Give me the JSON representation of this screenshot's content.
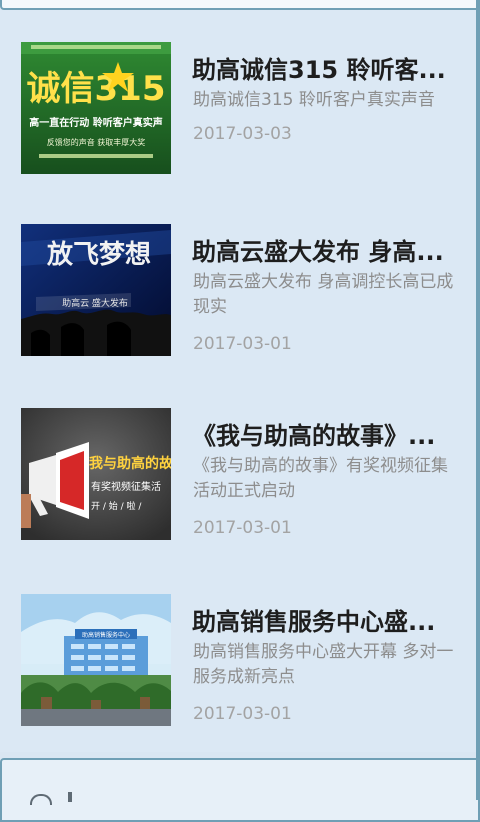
{
  "news": [
    {
      "title": "助高诚信315 聆听客...",
      "summary": "助高诚信315 聆听客户真实声音",
      "date": "2017-03-03",
      "thumb_text": "诚信315",
      "thumb_line1": "高一直在行动 聆听客户真实声",
      "thumb_line2": "反馈您的声音 获取丰厚大奖"
    },
    {
      "title": "助高云盛大发布 身高...",
      "summary": "助高云盛大发布 身高调控长高已成现实",
      "date": "2017-03-01",
      "thumb_text": "放飞梦想",
      "thumb_line1": "助高云 盛大发布"
    },
    {
      "title": "《我与助高的故事》...",
      "summary": "《我与助高的故事》有奖视频征集活动正式启动",
      "date": "2017-03-01",
      "thumb_text": "我与助高的故事",
      "thumb_line1": "有奖视频征集活",
      "thumb_line2": "开 / 始 / 啦 /"
    },
    {
      "title": "助高销售服务中心盛...",
      "summary": "助高销售服务中心盛大开幕 多对一服务成新亮点",
      "date": "2017-03-01",
      "thumb_text": "助高销售服务中心"
    }
  ],
  "colors": {
    "background": "#d9e6f2",
    "card_border": "#6f9fb5",
    "title": "#1e1e1e",
    "summary": "#8d8d8d",
    "date": "#a3a3a3"
  }
}
